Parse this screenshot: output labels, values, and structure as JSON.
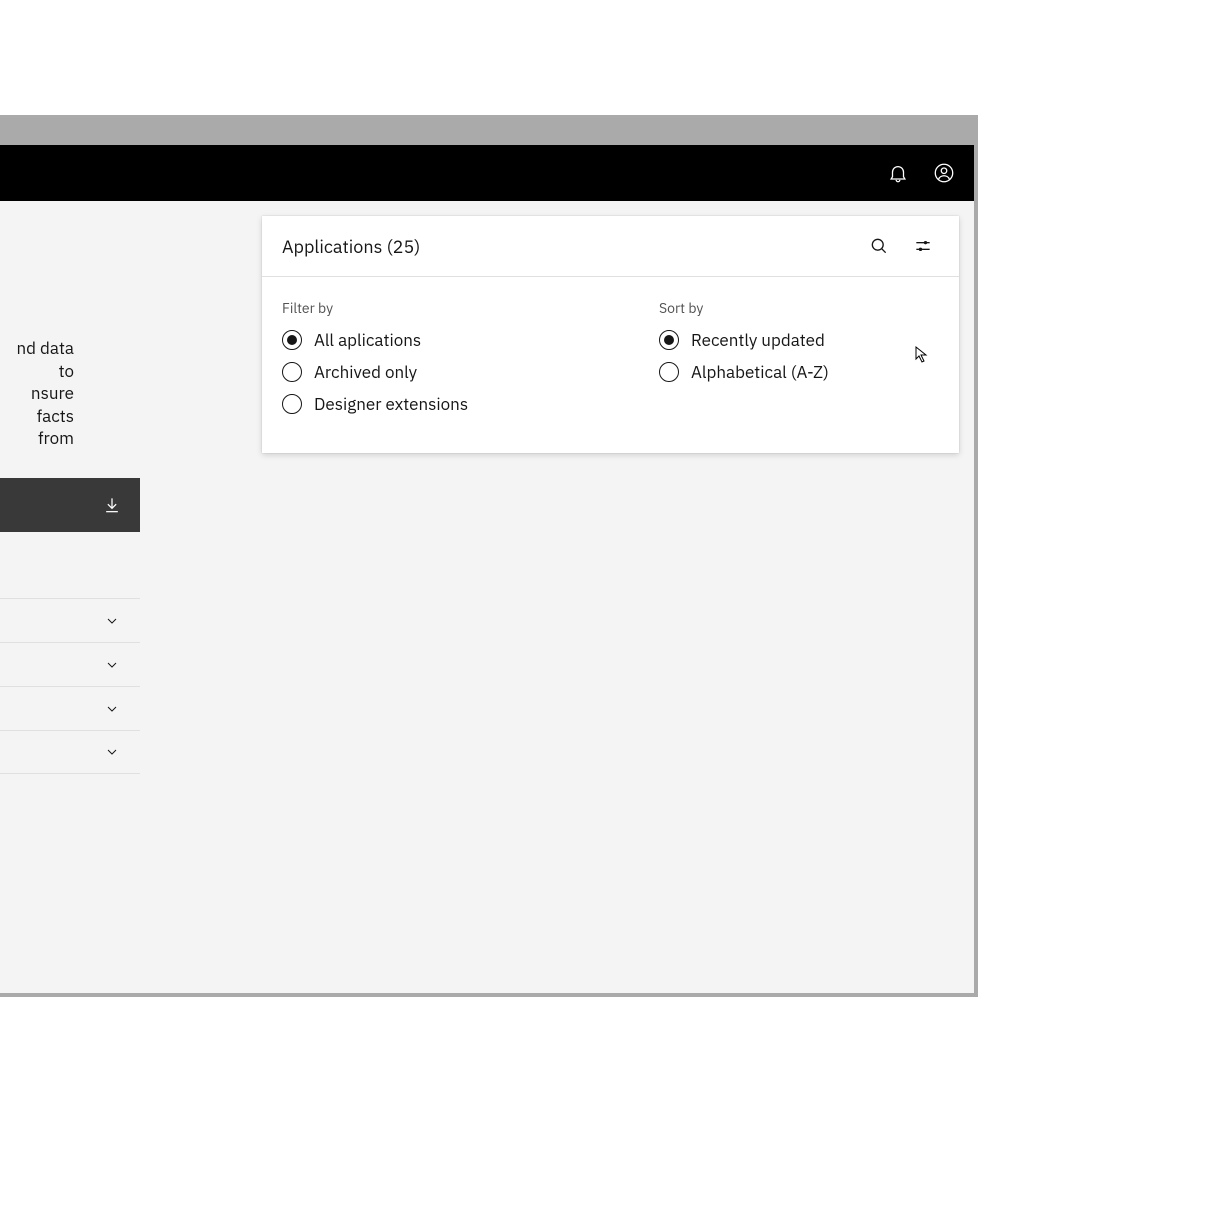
{
  "header": {
    "icons": {
      "notifications": "bell-icon",
      "account": "account-icon"
    }
  },
  "left": {
    "partial_text_line1": "nd data to",
    "partial_text_line2": "nsure",
    "partial_text_line3": "facts from",
    "download_icon": "download-icon",
    "accordion_count": 4
  },
  "panel": {
    "title": "Applications (25)",
    "search_icon": "search-icon",
    "filter_icon": "sliders-icon",
    "filter": {
      "label": "Filter by",
      "options": [
        {
          "label": "All aplications",
          "selected": true
        },
        {
          "label": "Archived only",
          "selected": false
        },
        {
          "label": "Designer extensions",
          "selected": false
        }
      ]
    },
    "sort": {
      "label": "Sort by",
      "options": [
        {
          "label": "Recently updated",
          "selected": true
        },
        {
          "label": "Alphabetical (A-Z)",
          "selected": false
        }
      ]
    }
  }
}
